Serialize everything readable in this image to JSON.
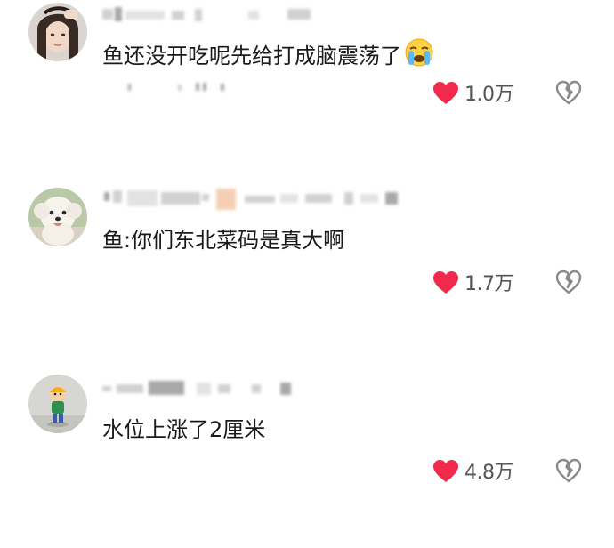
{
  "comments": [
    {
      "avatar": "woman-photo-avatar",
      "text": "鱼还没开吃呢先给打成脑震荡了",
      "emoji": "loudly-crying-face-emoji",
      "likes": "1.0万"
    },
    {
      "avatar": "white-dog-photo-avatar",
      "text": "鱼:你们东北菜码是真大啊",
      "likes": "1.7万"
    },
    {
      "avatar": "toy-figure-photo-avatar",
      "text": "水位上涨了2厘米",
      "likes": "4.8万"
    }
  ],
  "colors": {
    "like_heart": "#f0294d",
    "count_text": "#555555",
    "dislike_outline": "#8a8a8a"
  }
}
